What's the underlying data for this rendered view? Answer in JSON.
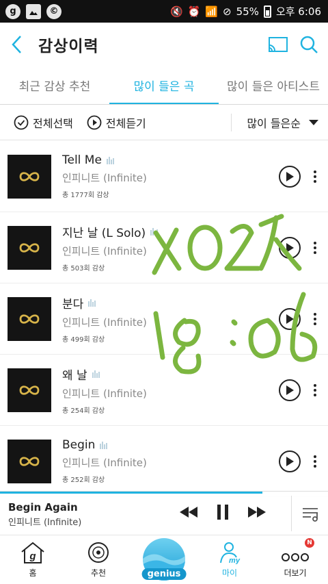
{
  "status_bar": {
    "left_icons": [
      "g",
      "",
      "©"
    ],
    "battery": "55%",
    "time": "오후 6:06"
  },
  "header": {
    "title": "감상이력"
  },
  "tabs": [
    {
      "label": "최근 감상 추천"
    },
    {
      "label": "많이 들은 곡"
    },
    {
      "label": "많이 들은 아티스트"
    }
  ],
  "toolbar": {
    "select_all": "전체선택",
    "play_all": "전체듣기",
    "sort": "많이 들은순"
  },
  "songs": [
    {
      "title": "Tell Me",
      "artist": "인피니트 (Infinite)",
      "plays": "총 1777회 감상"
    },
    {
      "title": "지난 날 (L Solo)",
      "artist": "인피니트 (Infinite)",
      "plays": "총 503회 감상"
    },
    {
      "title": "분다",
      "artist": "인피니트 (Infinite)",
      "plays": "총 499회 감상"
    },
    {
      "title": "왜 날",
      "artist": "인피니트 (Infinite)",
      "plays": "총 254회 감상"
    },
    {
      "title": "Begin",
      "artist": "인피니트 (Infinite)",
      "plays": "총 252회 감상"
    }
  ],
  "now_playing": {
    "title": "Begin Again",
    "artist": "인피니트 (Infinite)",
    "progress": 0.8
  },
  "bottom_nav": [
    {
      "label": "홈"
    },
    {
      "label": "추천"
    },
    {
      "label": "genius"
    },
    {
      "label": "마이"
    },
    {
      "label": "더보기",
      "badge": "N"
    }
  ],
  "colors": {
    "accent": "#1fb3e0",
    "handwriting": "#7cb640"
  }
}
